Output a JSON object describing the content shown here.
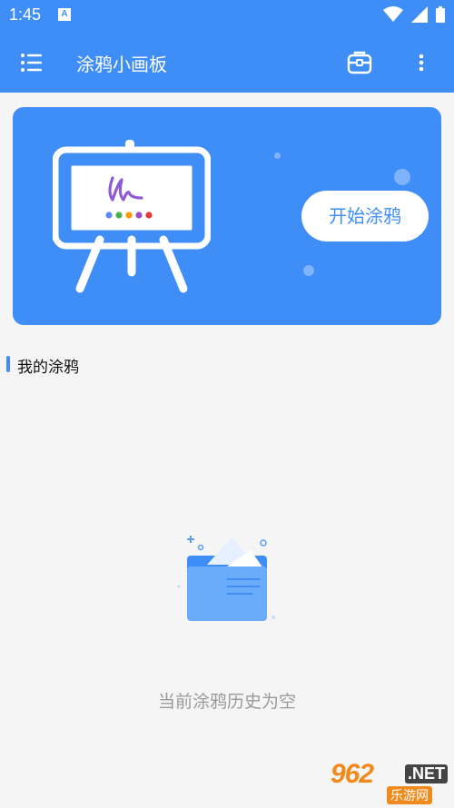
{
  "status_bar": {
    "time": "1:45",
    "notification_icon": "font-a-icon",
    "icons": [
      "wifi-icon",
      "cell-signal-icon",
      "battery-icon"
    ],
    "color": "#3f8ef7"
  },
  "app_bar": {
    "title": "涂鸦小画板",
    "menu_icon": "menu-list-icon",
    "toolbox_icon": "toolbox-icon",
    "more_icon": "more-vertical-icon",
    "color": "#3f8ef7"
  },
  "banner": {
    "start_label": "开始涂鸦",
    "palette_colors": [
      "#5b8df5",
      "#4caf50",
      "#ff9800",
      "#9c4dcc",
      "#e53935"
    ],
    "scribble_color": "#8e5bd4"
  },
  "section": {
    "title": "我的涂鸦"
  },
  "empty_state": {
    "illustration": "empty-folder-icon",
    "message": "当前涂鸦历史为空"
  },
  "watermark": {
    "main": "962",
    "net": ".NET",
    "cn": "乐游网"
  }
}
